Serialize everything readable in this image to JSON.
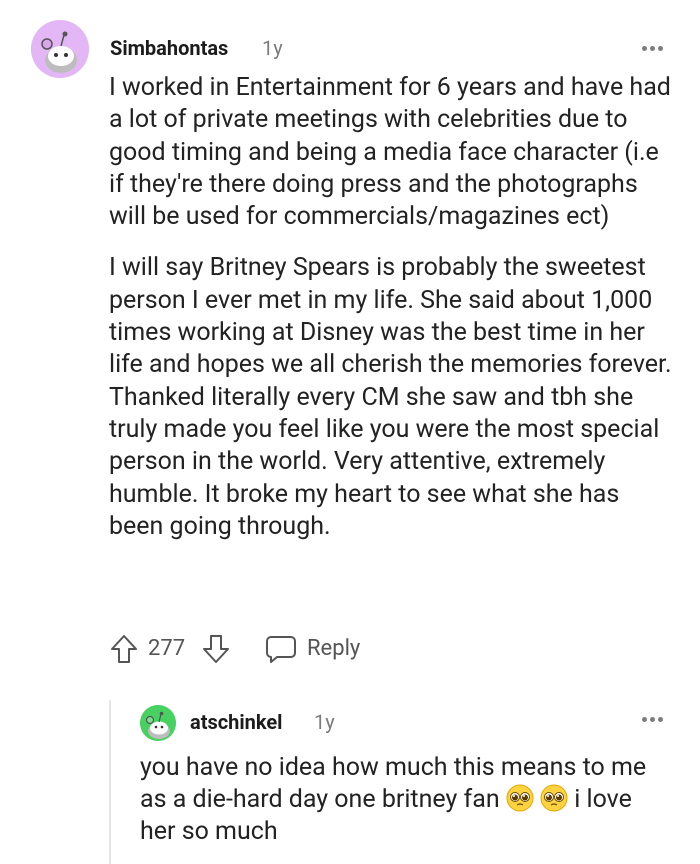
{
  "main_comment": {
    "username": "Simbahontas",
    "age": "1y",
    "paragraphs": [
      "I worked in Entertainment for 6 years and have had a lot of private meetings with celebrities due to good timing and being a media face character (i.e if they're there doing press and the photographs will be used for commercials/magazines ect)",
      "I will say Britney Spears is probably the sweetest person I ever met in my life. She said about 1,000 times working at Disney was the best time in her life and hopes we all cherish the memories forever. Thanked literally every CM she saw and tbh she truly made you feel like you were the most special person in the world. Very attentive, extremely humble. It broke my heart to see what she has been going through."
    ],
    "vote_count": "277",
    "reply_label": "Reply",
    "avatar_color": "#e3b7f5"
  },
  "reply_comment": {
    "username": "atschinkel",
    "age": "1y",
    "text_before_emoji": "you have no idea how much this means to me as a die-hard day one britney fan ",
    "text_after_emoji": " i love her so much",
    "emoji_icon": "pleading-face-icon",
    "avatar_color": "#46d160"
  },
  "icons": {
    "more": "more-options-icon",
    "upvote": "upvote-arrow-icon",
    "downvote": "downvote-arrow-icon",
    "reply": "reply-bubble-icon"
  }
}
